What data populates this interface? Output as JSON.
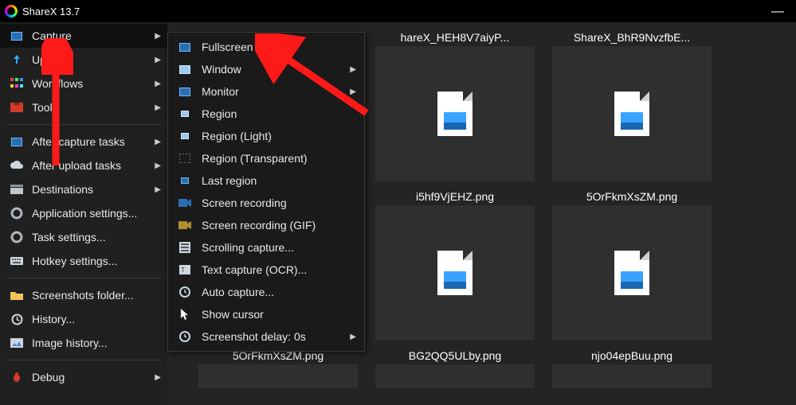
{
  "window": {
    "title": "ShareX 13.7"
  },
  "sidebar": {
    "items": [
      {
        "label": "Capture",
        "submenu": true,
        "icon": "monitor-icon"
      },
      {
        "label": "Upload",
        "submenu": true,
        "icon": "upload-icon"
      },
      {
        "label": "Workflows",
        "submenu": true,
        "icon": "workflows-icon"
      },
      {
        "label": "Tools",
        "submenu": true,
        "icon": "toolbox-icon"
      },
      {
        "sep": true
      },
      {
        "label": "After capture tasks",
        "submenu": true,
        "icon": "monitor-icon"
      },
      {
        "label": "After upload tasks",
        "submenu": true,
        "icon": "cloud-icon"
      },
      {
        "label": "Destinations",
        "submenu": true,
        "icon": "drive-icon"
      },
      {
        "label": "Application settings...",
        "submenu": false,
        "icon": "gear-icon"
      },
      {
        "label": "Task settings...",
        "submenu": false,
        "icon": "gear-icon"
      },
      {
        "label": "Hotkey settings...",
        "submenu": false,
        "icon": "keyboard-icon"
      },
      {
        "sep": true
      },
      {
        "label": "Screenshots folder...",
        "submenu": false,
        "icon": "folder-icon"
      },
      {
        "label": "History...",
        "submenu": false,
        "icon": "clock-icon"
      },
      {
        "label": "Image history...",
        "submenu": false,
        "icon": "image-icon"
      },
      {
        "sep": true
      },
      {
        "label": "Debug",
        "submenu": true,
        "icon": "bug-icon"
      }
    ]
  },
  "capture_menu": {
    "items": [
      {
        "label": "Fullscreen",
        "submenu": false,
        "icon": "monitor-icon"
      },
      {
        "label": "Window",
        "submenu": true,
        "icon": "window-icon"
      },
      {
        "label": "Monitor",
        "submenu": true,
        "icon": "monitor-icon"
      },
      {
        "label": "Region",
        "submenu": false,
        "icon": "region-icon"
      },
      {
        "label": "Region (Light)",
        "submenu": false,
        "icon": "region-icon"
      },
      {
        "label": "Region (Transparent)",
        "submenu": false,
        "icon": "region-icon"
      },
      {
        "label": "Last region",
        "submenu": false,
        "icon": "region-icon"
      },
      {
        "label": "Screen recording",
        "submenu": false,
        "icon": "record-icon"
      },
      {
        "label": "Screen recording (GIF)",
        "submenu": false,
        "icon": "record-icon"
      },
      {
        "label": "Scrolling capture...",
        "submenu": false,
        "icon": "scroll-icon"
      },
      {
        "label": "Text capture (OCR)...",
        "submenu": false,
        "icon": "ocr-icon"
      },
      {
        "label": "Auto capture...",
        "submenu": false,
        "icon": "clock-icon"
      },
      {
        "label": "Show cursor",
        "submenu": false,
        "icon": "cursor-icon"
      },
      {
        "label": "Screenshot delay: 0s",
        "submenu": true,
        "icon": "clock-icon"
      }
    ]
  },
  "thumbs": {
    "row1": [
      {
        "caption": "hareX_HEH8V7aiyP..."
      },
      {
        "caption": "ShareX_BhR9NvzfbE..."
      }
    ],
    "row2": [
      {
        "caption": "i5hf9VjEHZ.png"
      },
      {
        "caption": "5OrFkmXsZM.png"
      }
    ],
    "row3": [
      {
        "caption": "5OrFkmXsZM.png"
      },
      {
        "caption": "BG2QQ5ULby.png"
      },
      {
        "caption": "njo04epBuu.png"
      }
    ]
  }
}
